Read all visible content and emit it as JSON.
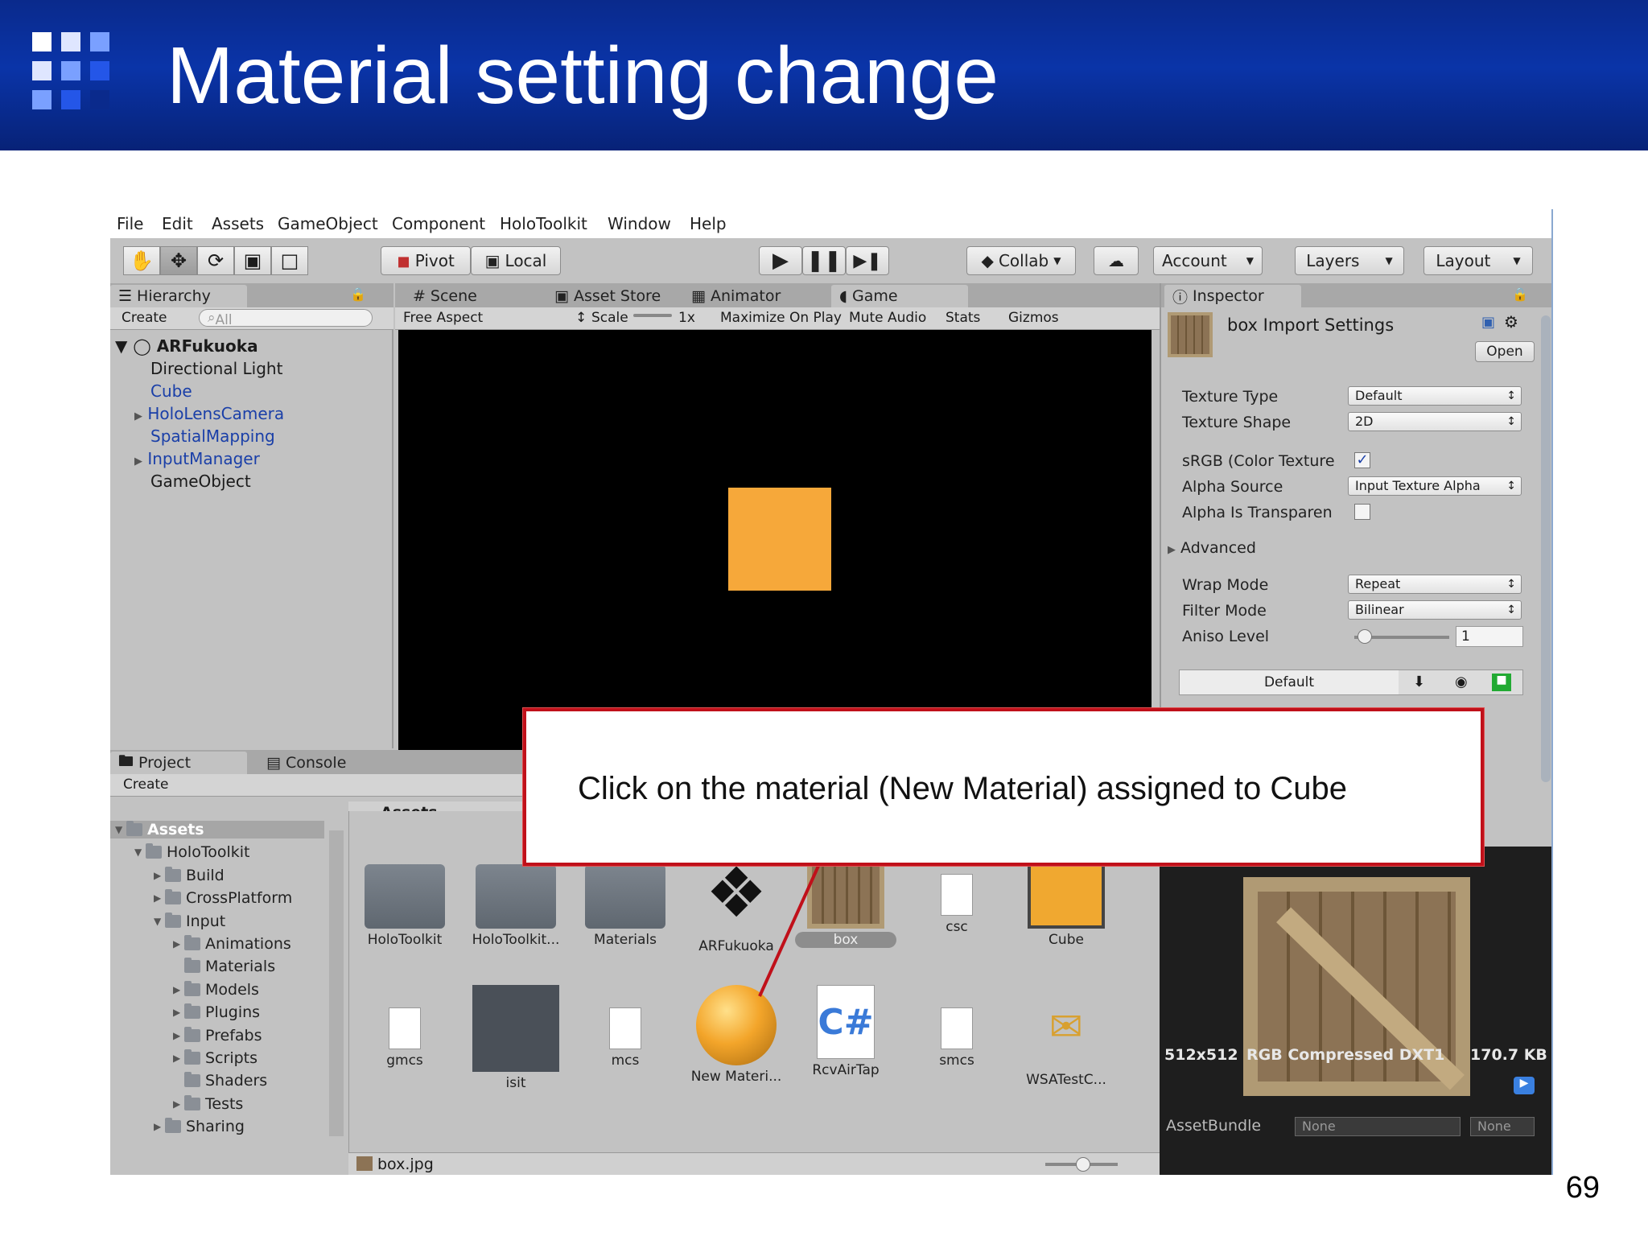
{
  "slide": {
    "title": "Material setting change",
    "page_number": "69",
    "colors": {
      "header": "#0a2a8c",
      "callout_border": "#c0101a",
      "cube": "#f6a83a"
    }
  },
  "menu": [
    "File",
    "Edit",
    "Assets",
    "GameObject",
    "Component",
    "HoloToolkit",
    "Window",
    "Help"
  ],
  "toolbar": {
    "pivot": "Pivot",
    "local": "Local",
    "collab": "Collab",
    "account": "Account",
    "layers": "Layers",
    "layout": "Layout"
  },
  "hierarchy": {
    "tab": "Hierarchy",
    "create": "Create",
    "search_placeholder": "All",
    "scene": "ARFukuoka",
    "items": [
      "Directional Light",
      "Cube",
      "HoloLensCamera",
      "SpatialMapping",
      "InputManager",
      "GameObject"
    ]
  },
  "center_tabs": [
    "Scene",
    "Asset Store",
    "Animator",
    "Game"
  ],
  "game_bar": {
    "aspect": "Free Aspect",
    "scale_label": "Scale",
    "scale_value": "1x",
    "maximize": "Maximize On Play",
    "mute": "Mute Audio",
    "stats": "Stats",
    "gizmos": "Gizmos"
  },
  "inspector": {
    "tab": "Inspector",
    "header": "box Import Settings",
    "open": "Open",
    "rows": [
      {
        "label": "Texture Type",
        "value": "Default"
      },
      {
        "label": "Texture Shape",
        "value": "2D"
      },
      {
        "label": "sRGB (Color Texture",
        "value": ""
      },
      {
        "label": "Alpha Source",
        "value": "Input Texture Alpha"
      },
      {
        "label": "Alpha Is Transparen",
        "value": ""
      },
      {
        "label": "Advanced",
        "value": ""
      },
      {
        "label": "Wrap Mode",
        "value": "Repeat"
      },
      {
        "label": "Filter Mode",
        "value": "Bilinear"
      },
      {
        "label": "Aniso Level",
        "value": "1"
      }
    ],
    "platform_tab": "Default"
  },
  "project": {
    "tabs": [
      "Project",
      "Console"
    ],
    "create": "Create",
    "breadcrumb": "Assets",
    "tree": [
      {
        "label": "Assets",
        "depth": 0,
        "arrow": "open"
      },
      {
        "label": "HoloToolkit",
        "depth": 1,
        "arrow": "open"
      },
      {
        "label": "Build",
        "depth": 2,
        "arrow": "closed"
      },
      {
        "label": "CrossPlatform",
        "depth": 2,
        "arrow": "closed"
      },
      {
        "label": "Input",
        "depth": 2,
        "arrow": "open"
      },
      {
        "label": "Animations",
        "depth": 3,
        "arrow": "closed"
      },
      {
        "label": "Materials",
        "depth": 3,
        "arrow": "none"
      },
      {
        "label": "Models",
        "depth": 3,
        "arrow": "closed"
      },
      {
        "label": "Plugins",
        "depth": 3,
        "arrow": "closed"
      },
      {
        "label": "Prefabs",
        "depth": 3,
        "arrow": "closed"
      },
      {
        "label": "Scripts",
        "depth": 3,
        "arrow": "closed"
      },
      {
        "label": "Shaders",
        "depth": 3,
        "arrow": "none"
      },
      {
        "label": "Tests",
        "depth": 3,
        "arrow": "closed"
      },
      {
        "label": "Sharing",
        "depth": 2,
        "arrow": "closed"
      }
    ],
    "assets_row1": [
      "HoloToolkit",
      "HoloToolkit...",
      "Materials",
      "ARFukuoka",
      "box",
      "csc",
      "Cube"
    ],
    "assets_row2": [
      "gmcs",
      "isit",
      "mcs",
      "New Materi...",
      "RcvAirTap",
      "smcs",
      "WSATestC..."
    ],
    "selected_file": "box.jpg"
  },
  "preview": {
    "info_size": "512x512",
    "info_format": "RGB Compressed DXT1",
    "info_bytes": "170.7 KB",
    "assetbundle_label": "AssetBundle",
    "assetbundle_value": "None",
    "variant_value": "None"
  },
  "callout": {
    "text": "Click on the material (New Material) assigned to Cube"
  }
}
